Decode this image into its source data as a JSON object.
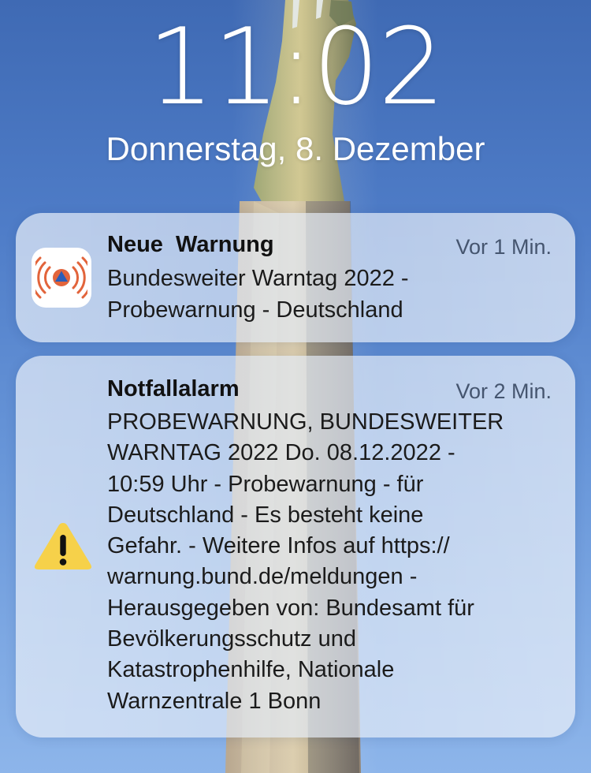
{
  "lock_screen": {
    "time": "11:02",
    "date": "Donnerstag, 8. Dezember"
  },
  "notifications": [
    {
      "icon": "nina-warning-app-icon",
      "title": "Neue  Warnung",
      "time": "Vor 1 Min.",
      "body": "Bundesweiter Warntag 2022 -\nProbewarnung - Deutschland"
    },
    {
      "icon": "warning-triangle-icon",
      "title": "Notfallalarm",
      "time": "Vor 2 Min.",
      "body": "PROBEWARNUNG, BUNDESWEITER\nWARNTAG 2022 Do. 08.12.2022 -\n10:59 Uhr - Probewarnung - für\nDeutschland - Es besteht keine\nGefahr. - Weitere Infos auf https://\nwarnung.bund.de/meldungen -\nHerausgegeben von: Bundesamt für\nBevölkerungsschutz und\nKatastrophenhilfe, Nationale\nWarnzentrale 1 Bonn"
    }
  ],
  "colors": {
    "sky": "#4f7dc8",
    "icon_orange": "#e2643b",
    "icon_blue": "#2b5db8",
    "warning_yellow": "#f6d14a"
  }
}
